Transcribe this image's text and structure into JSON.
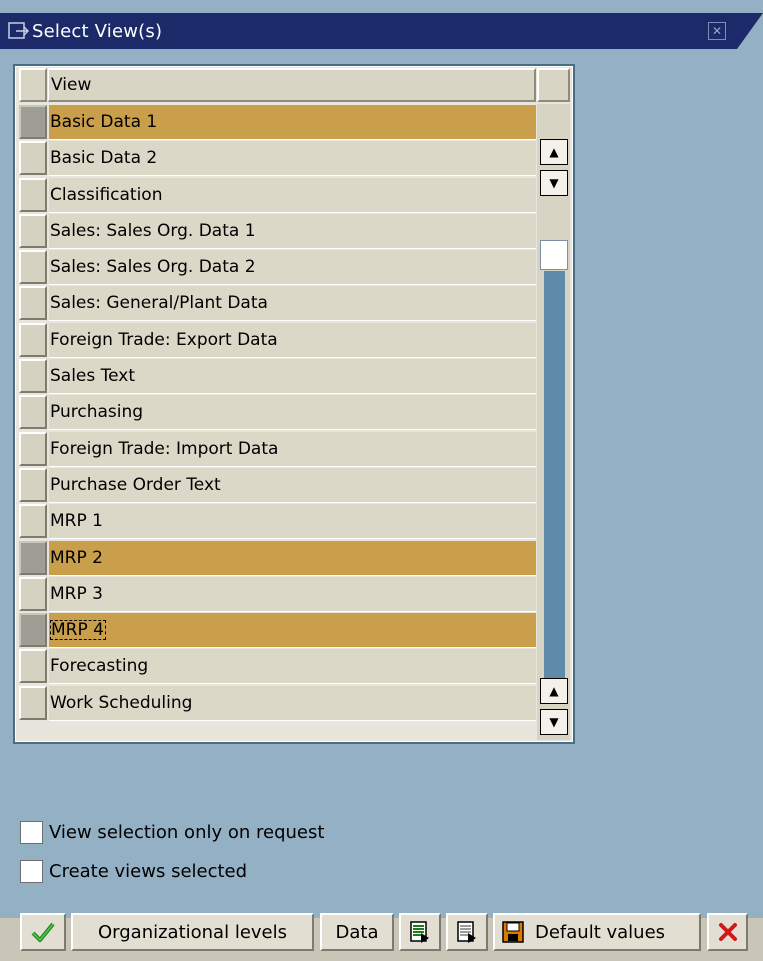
{
  "window": {
    "title": "Select View(s)"
  },
  "table": {
    "column_header": "View",
    "rows": [
      {
        "label": "Basic Data 1",
        "selected": true
      },
      {
        "label": "Basic Data 2",
        "selected": false
      },
      {
        "label": "Classification",
        "selected": false
      },
      {
        "label": "Sales: Sales Org. Data 1",
        "selected": false
      },
      {
        "label": "Sales: Sales Org. Data 2",
        "selected": false
      },
      {
        "label": "Sales: General/Plant Data",
        "selected": false
      },
      {
        "label": "Foreign Trade: Export Data",
        "selected": false
      },
      {
        "label": "Sales Text",
        "selected": false
      },
      {
        "label": "Purchasing",
        "selected": false
      },
      {
        "label": "Foreign Trade: Import Data",
        "selected": false
      },
      {
        "label": "Purchase Order Text",
        "selected": false
      },
      {
        "label": "MRP 1",
        "selected": false
      },
      {
        "label": "MRP 2",
        "selected": true
      },
      {
        "label": "MRP 3",
        "selected": false
      },
      {
        "label": "MRP 4",
        "selected": true
      },
      {
        "label": "Forecasting",
        "selected": false
      },
      {
        "label": "Work Scheduling",
        "selected": false
      }
    ]
  },
  "options": {
    "view_selection_label": "View selection only on request",
    "view_selection_checked": false,
    "create_views_label": "Create views selected",
    "create_views_checked": false
  },
  "toolbar": {
    "confirm_icon": "checkmark-icon",
    "org_levels_label": "Organizational levels",
    "data_label": "Data",
    "default_values_label": "Default values",
    "cancel_icon": "cancel-icon"
  },
  "colors": {
    "title_bar": "#1c2a6a",
    "background": "#94b0c4",
    "selected_row": "#c99f4c",
    "row": "#dcd8c8"
  }
}
